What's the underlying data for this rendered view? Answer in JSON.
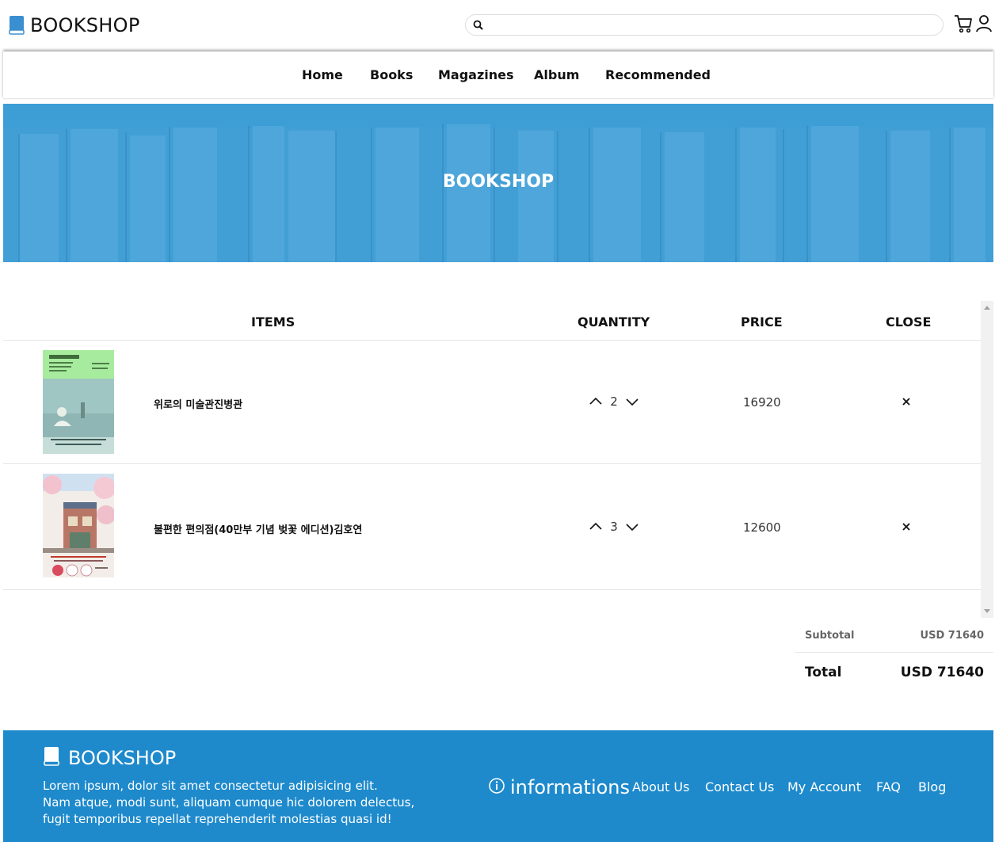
{
  "header": {
    "brand": "BOOKSHOP",
    "search": {
      "placeholder": "",
      "value": ""
    }
  },
  "nav": {
    "items": [
      {
        "label": "Home"
      },
      {
        "label": "Books"
      },
      {
        "label": "Magazines"
      },
      {
        "label": "Album"
      },
      {
        "label": "Recommended"
      }
    ]
  },
  "hero": {
    "title": "BOOKSHOP"
  },
  "cart": {
    "headers": {
      "items": "ITEMS",
      "quantity": "QUANTITY",
      "price": "PRICE",
      "close": "CLOSE"
    },
    "rows": [
      {
        "name": "위로의 미술관진병관",
        "quantity": "2",
        "price": "16920"
      },
      {
        "name": "불편한 편의점(40만부 기념 벚꽃 에디션)김호연",
        "quantity": "3",
        "price": "12600"
      }
    ]
  },
  "totals": {
    "subtotal_label": "Subtotal",
    "subtotal_value": "USD 71640",
    "total_label": "Total",
    "total_value": "USD 71640"
  },
  "footer": {
    "brand": "BOOKSHOP",
    "about_lines": [
      "Lorem ipsum, dolor sit amet consectetur adipisicing elit.",
      "Nam atque, modi sunt, aliquam cumque hic dolorem delectus,",
      "fugit temporibus repellat reprehenderit molestias quasi id!"
    ],
    "info_title": "informations",
    "links": [
      {
        "label": "About Us"
      },
      {
        "label": "Contact Us"
      },
      {
        "label": "My Account"
      },
      {
        "label": "FAQ"
      },
      {
        "label": "Blog"
      }
    ]
  },
  "colors": {
    "brand_blue": "#1e8acc",
    "hero_blue": "#3d9ed6",
    "logo_icon": "#3a8fd0"
  }
}
